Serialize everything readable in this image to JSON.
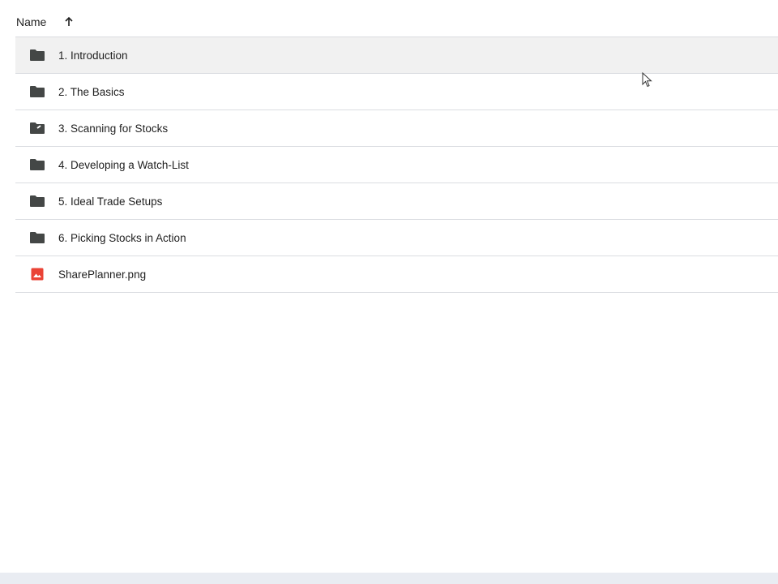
{
  "header": {
    "name_label": "Name",
    "sort_icon": "arrow-up-icon"
  },
  "files": [
    {
      "label": "1. Introduction",
      "icon": "folder-icon"
    },
    {
      "label": "2. The Basics",
      "icon": "folder-icon"
    },
    {
      "label": "3. Scanning for Stocks",
      "icon": "shared-folder-icon"
    },
    {
      "label": "4. Developing a Watch-List",
      "icon": "folder-icon"
    },
    {
      "label": "5. Ideal Trade Setups",
      "icon": "folder-icon"
    },
    {
      "label": "6. Picking Stocks in Action",
      "icon": "folder-icon"
    },
    {
      "label": "SharePlanner.png",
      "icon": "image-file-icon"
    }
  ],
  "colors": {
    "folder": "#444746",
    "image_file": "#ea4335",
    "selected_row": "#f1f1f1",
    "divider": "#dadce0"
  }
}
